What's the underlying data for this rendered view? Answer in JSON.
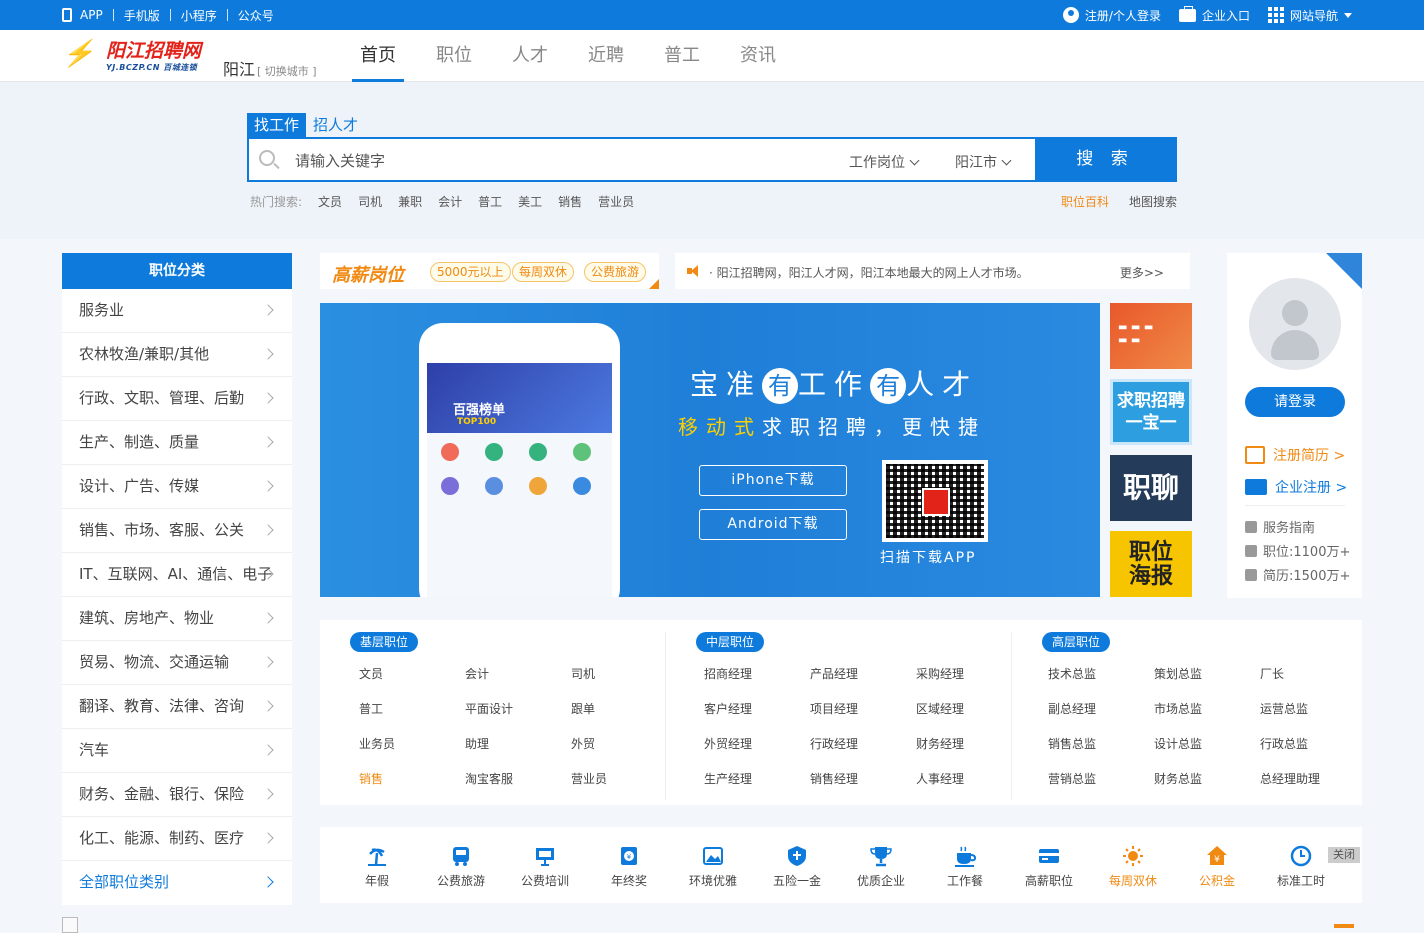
{
  "topbar": {
    "links": [
      "APP",
      "手机版",
      "小程序",
      "公众号"
    ],
    "login": "注册/个人登录",
    "enterprise": "企业入口",
    "site_nav": "网站导航"
  },
  "header": {
    "logo_text": "阳江招聘网",
    "logo_sub": "YJ.BCZP.CN 百城连锁",
    "city": "阳江",
    "switch_city": "[ 切换城市 ]",
    "nav": [
      "首页",
      "职位",
      "人才",
      "近聘",
      "普工",
      "资讯"
    ]
  },
  "search": {
    "tabs": [
      "找工作",
      "招人才"
    ],
    "placeholder": "请输入关键字",
    "job_select": "工作岗位",
    "city_select": "阳江市",
    "button": "搜 索",
    "hot_label": "热门搜索:",
    "hot_words": [
      "文员",
      "司机",
      "兼职",
      "会计",
      "普工",
      "美工",
      "销售",
      "营业员"
    ],
    "links": [
      "职位百科",
      "地图搜索"
    ]
  },
  "categories": {
    "title": "职位分类",
    "items": [
      "服务业",
      "农林牧渔/兼职/其他",
      "行政、文职、管理、后勤",
      "生产、制造、质量",
      "设计、广告、传媒",
      "销售、市场、客服、公关",
      "IT、互联网、AI、通信、电子",
      "建筑、房地产、物业",
      "贸易、物流、交通运输",
      "翻译、教育、法律、咨询",
      "汽车",
      "财务、金融、银行、保险",
      "化工、能源、制药、医疗"
    ],
    "all": "全部职位类别"
  },
  "hi_salary": {
    "logo": "高薪岗位",
    "tags": [
      "5000元以上",
      "每周双休",
      "公费旅游"
    ]
  },
  "notice": {
    "text": "· 阳江招聘网，阳江人才网，阳江本地最大的网上人才市场。",
    "more": "更多>>"
  },
  "banner": {
    "phone_title": "百强榜单",
    "phone_top": "TOP100",
    "headline": [
      "宝",
      "准",
      "有",
      "工",
      "作",
      "有",
      "人",
      "才"
    ],
    "sub_yellow": "移动式",
    "sub_white": "求职招聘，更快捷",
    "iphone": "iPhone下载",
    "android": "Android下载",
    "qr_label": "扫描下载APP"
  },
  "side_ads": {
    "a2": "求职招聘一宝一",
    "a3": "职聊",
    "a4_1": "职位",
    "a4_2": "海报"
  },
  "login_panel": {
    "login_btn": "请登录",
    "reg_resume": "注册简历 >",
    "reg_company": "企业注册 >",
    "guide": "服务指南",
    "jobs": "职位:1100万+",
    "resumes": "简历:1500万+"
  },
  "levels": [
    {
      "title": "基层职位",
      "items": [
        "文员",
        "会计",
        "司机",
        "普工",
        "平面设计",
        "跟单",
        "业务员",
        "助理",
        "外贸",
        "销售",
        "淘宝客服",
        "营业员"
      ]
    },
    {
      "title": "中层职位",
      "items": [
        "招商经理",
        "产品经理",
        "采购经理",
        "客户经理",
        "项目经理",
        "区域经理",
        "外贸经理",
        "行政经理",
        "财务经理",
        "生产经理",
        "销售经理",
        "人事经理"
      ]
    },
    {
      "title": "高层职位",
      "items": [
        "技术总监",
        "策划总监",
        "厂长",
        "副总经理",
        "市场总监",
        "运营总监",
        "销售总监",
        "设计总监",
        "行政总监",
        "营销总监",
        "财务总监",
        "总经理助理"
      ]
    }
  ],
  "benefits": {
    "items": [
      "年假",
      "公费旅游",
      "公费培训",
      "年终奖",
      "环境优雅",
      "五险一金",
      "优质企业",
      "工作餐",
      "高薪职位",
      "每周双休",
      "公积金",
      "标准工时"
    ],
    "close": "关闭"
  },
  "colors": {
    "primary": "#0e7bdc",
    "accent": "#f08a13",
    "brand_red": "#e2231a"
  }
}
